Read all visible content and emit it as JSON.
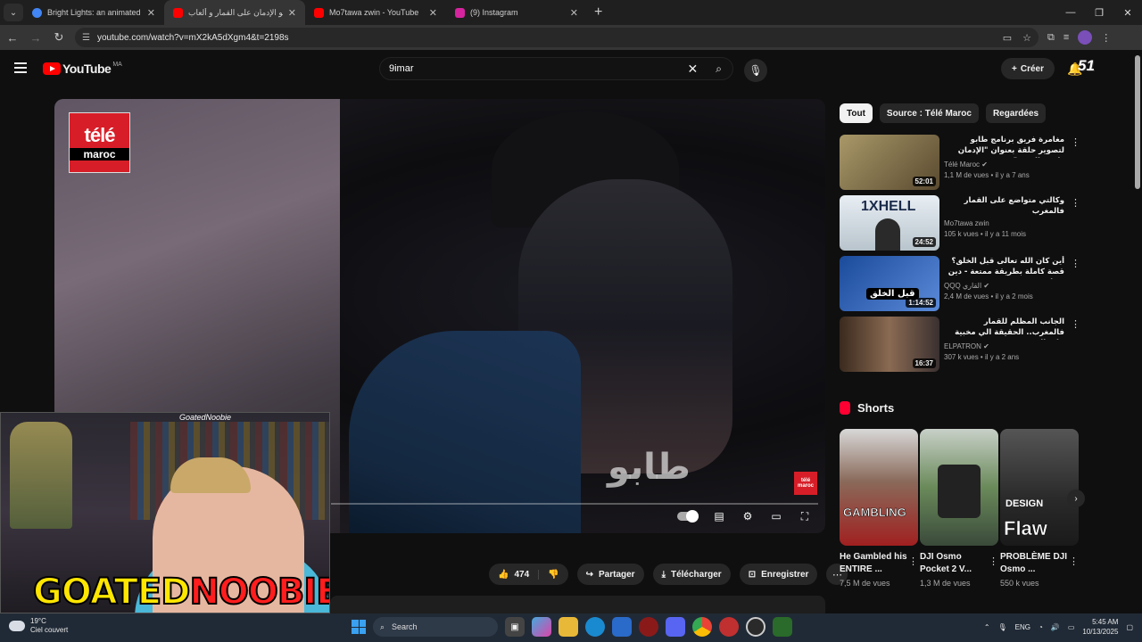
{
  "browser": {
    "tabs": [
      {
        "title": "Bright Lights: an animated exp",
        "color": "#4285f4",
        "active": false
      },
      {
        "title": "طابو الإدمان على القمار و ألعاب",
        "color": "#ff0000",
        "active": true
      },
      {
        "title": "Mo7tawa zwin - YouTube",
        "color": "#ff0000",
        "active": false
      },
      {
        "title": "(9) Instagram",
        "color": "#d6249f",
        "active": false
      }
    ],
    "url": "youtube.com/watch?v=mX2kA5dXgm4&t=2198s"
  },
  "youtube": {
    "logo_word": "YouTube",
    "country": "MA",
    "search_query": "9imar",
    "create_label": "Créer",
    "notif_count": "51"
  },
  "video": {
    "channel_logo_line1": "télé",
    "channel_logo_line2": "maroc",
    "overlay_text": "طابو",
    "corner_logo_1": "télé",
    "corner_logo_2": "maroc"
  },
  "webcam": {
    "cam_name": "GoatedNoobie",
    "banner_part1": "GOATED",
    "banner_part2": "NOOBIE"
  },
  "actions": {
    "like_count": "474",
    "share_label": "Partager",
    "download_label": "Télécharger",
    "save_label": "Enregistrer"
  },
  "chips": [
    "Tout",
    "Source : Télé Maroc",
    "Regardées"
  ],
  "recommendations": [
    {
      "title": "مغامرة فريق برنامج طابو لتصوير حلقة بعنوان \"الإدمان طريق الموت\"",
      "channel": "Télé Maroc ✔",
      "meta": "1,1 M de vues • il y a 7 ans",
      "duration": "52:01",
      "thumb_color": "#8a7a55"
    },
    {
      "title": "وكالتي متواضع على القمار فالمغرب",
      "channel": "Mo7tawa zwin",
      "meta": "105 k vues • il y a 11 mois",
      "duration": "24:52",
      "thumb_color": "#d8e4ee",
      "thumb_text": "1XHELL"
    },
    {
      "title": "أين كان الله تعالى قبل الخلق؟ قصة كاملة بطريقة ممتعة - دين و طين",
      "channel": "QQQ القاري ✔",
      "meta": "2,4 M de vues • il y a 2 mois",
      "duration": "1:14:52",
      "thumb_color": "#2a5aa8",
      "thumb_text": "قبل الخلق"
    },
    {
      "title": "الجانب المظلم للقمار فالمغرب.. الحقيقة الي مخبية على الشعب",
      "channel": "ELPATRON ✔",
      "meta": "307 k vues • il y a 2 ans",
      "duration": "16:37",
      "thumb_color": "#6a4a3a"
    }
  ],
  "shorts": {
    "heading": "Shorts",
    "items": [
      {
        "title": "He Gambled his ENTIRE ...",
        "views": "7,5 M de vues",
        "overlay": "GAMBLING",
        "color": "#b03030"
      },
      {
        "title": "DJI Osmo Pocket 2 V...",
        "views": "1,3 M de vues",
        "overlay": "",
        "color": "#6a8a5a"
      },
      {
        "title": "PROBLÈME DJI Osmo ...",
        "views": "550 k vues",
        "overlay": "Flaw",
        "overlay_top": "DESIGN",
        "color": "#3a3a3a"
      }
    ]
  },
  "taskbar": {
    "temp": "19°C",
    "weather": "Ciel couvert",
    "search_placeholder": "Search",
    "lang": "ENG",
    "time": "5:45 AM",
    "date": "10/13/2025"
  }
}
